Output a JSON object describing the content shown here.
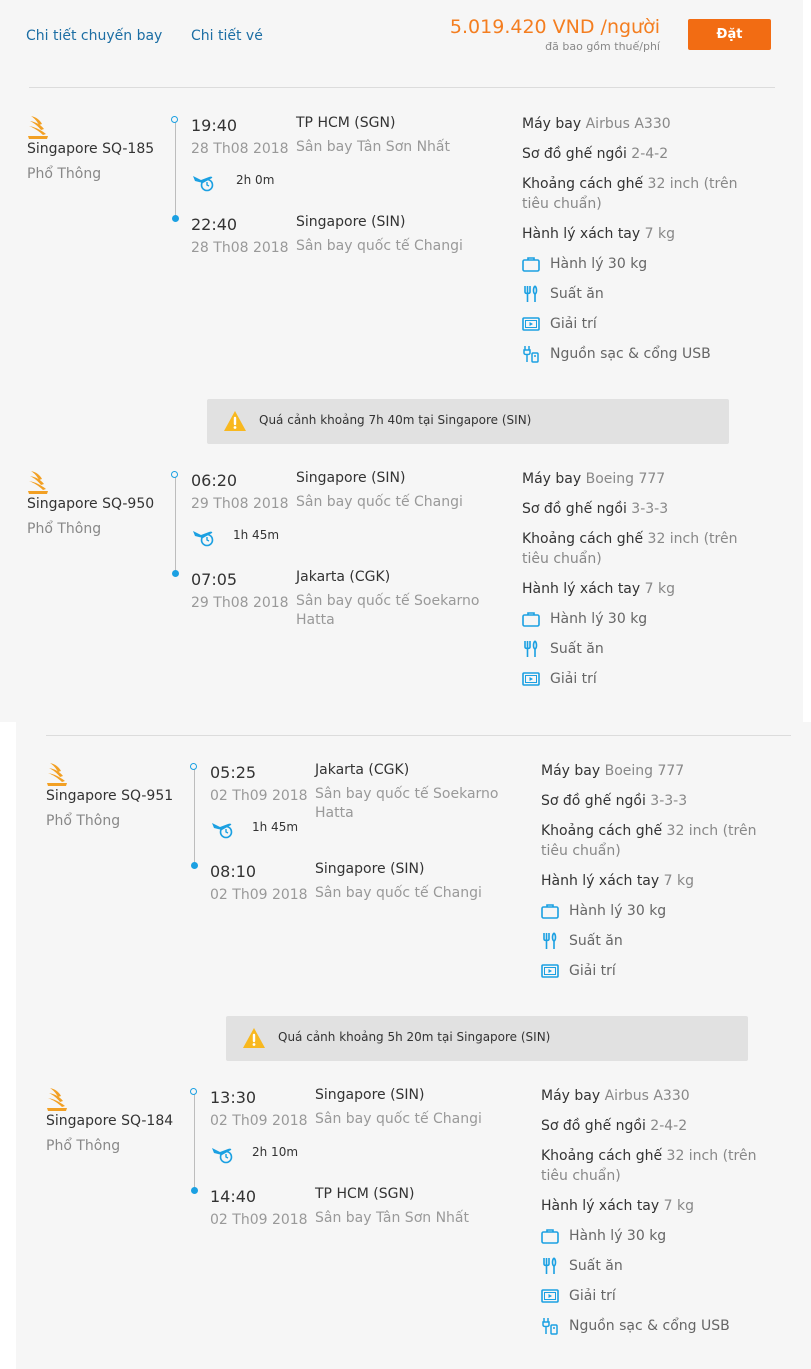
{
  "header": {
    "tabs": [
      "Chi tiết chuyến bay",
      "Chi tiết vé"
    ],
    "price": "5.019.420 VND /người",
    "price_note": "đã bao gồm thuế/phí",
    "book_label": "Đặt"
  },
  "colors": {
    "accent": "#1ba0e2",
    "price": "#f47e20",
    "button": "#f26c13",
    "link": "#1c6ea4"
  },
  "segments": [
    {
      "airline": "Singapore SQ-185",
      "cabin": "Phổ Thông",
      "dep_time": "19:40",
      "dep_date": "28 Th08 2018",
      "dep_city": "TP HCM (SGN)",
      "dep_airport": "Sân bay Tân Sơn Nhất",
      "duration": "2h 0m",
      "arr_time": "22:40",
      "arr_date": "28 Th08 2018",
      "arr_city": "Singapore (SIN)",
      "arr_airport": "Sân bay quốc tế Changi",
      "aircraft_label": "Máy bay",
      "aircraft": "Airbus A330",
      "seat_map_label": "Sơ đồ ghế ngồi",
      "seat_map": "2-4-2",
      "pitch_label": "Khoảng cách ghế",
      "pitch": "32 inch (trên tiêu chuẩn)",
      "cabin_bag_label": "Hành lý xách tay",
      "cabin_bag": "7 kg",
      "amenities": [
        "Hành lý 30 kg",
        "Suất ăn",
        "Giải trí",
        "Nguồn sạc & cổng USB"
      ]
    },
    {
      "airline": "Singapore SQ-950",
      "cabin": "Phổ Thông",
      "dep_time": "06:20",
      "dep_date": "29 Th08 2018",
      "dep_city": "Singapore (SIN)",
      "dep_airport": "Sân bay quốc tế Changi",
      "duration": "1h 45m",
      "arr_time": "07:05",
      "arr_date": "29 Th08 2018",
      "arr_city": "Jakarta (CGK)",
      "arr_airport": "Sân bay quốc tế Soekarno Hatta",
      "aircraft_label": "Máy bay",
      "aircraft": "Boeing 777",
      "seat_map_label": "Sơ đồ ghế ngồi",
      "seat_map": "3-3-3",
      "pitch_label": "Khoảng cách ghế",
      "pitch": "32 inch (trên tiêu chuẩn)",
      "cabin_bag_label": "Hành lý xách tay",
      "cabin_bag": "7 kg",
      "amenities": [
        "Hành lý 30 kg",
        "Suất ăn",
        "Giải trí"
      ]
    },
    {
      "airline": "Singapore SQ-951",
      "cabin": "Phổ Thông",
      "dep_time": "05:25",
      "dep_date": "02 Th09 2018",
      "dep_city": "Jakarta (CGK)",
      "dep_airport": "Sân bay quốc tế Soekarno Hatta",
      "duration": "1h 45m",
      "arr_time": "08:10",
      "arr_date": "02 Th09 2018",
      "arr_city": "Singapore (SIN)",
      "arr_airport": "Sân bay quốc tế Changi",
      "aircraft_label": "Máy bay",
      "aircraft": "Boeing 777",
      "seat_map_label": "Sơ đồ ghế ngồi",
      "seat_map": "3-3-3",
      "pitch_label": "Khoảng cách ghế",
      "pitch": "32 inch (trên tiêu chuẩn)",
      "cabin_bag_label": "Hành lý xách tay",
      "cabin_bag": "7 kg",
      "amenities": [
        "Hành lý 30 kg",
        "Suất ăn",
        "Giải trí"
      ]
    },
    {
      "airline": "Singapore SQ-184",
      "cabin": "Phổ Thông",
      "dep_time": "13:30",
      "dep_date": "02 Th09 2018",
      "dep_city": "Singapore (SIN)",
      "dep_airport": "Sân bay quốc tế Changi",
      "duration": "2h 10m",
      "arr_time": "14:40",
      "arr_date": "02 Th09 2018",
      "arr_city": "TP HCM (SGN)",
      "arr_airport": "Sân bay Tân Sơn Nhất",
      "aircraft_label": "Máy bay",
      "aircraft": "Airbus A330",
      "seat_map_label": "Sơ đồ ghế ngồi",
      "seat_map": "2-4-2",
      "pitch_label": "Khoảng cách ghế",
      "pitch": "32 inch (trên tiêu chuẩn)",
      "cabin_bag_label": "Hành lý xách tay",
      "cabin_bag": "7 kg",
      "amenities": [
        "Hành lý 30 kg",
        "Suất ăn",
        "Giải trí",
        "Nguồn sạc & cổng USB"
      ]
    }
  ],
  "layovers": [
    "Quá cảnh khoảng 7h 40m tại Singapore (SIN)",
    "Quá cảnh khoảng 5h 20m tại Singapore (SIN)"
  ],
  "amenity_icons": [
    "luggage-icon",
    "meal-icon",
    "entertainment-icon",
    "power-usb-icon"
  ]
}
